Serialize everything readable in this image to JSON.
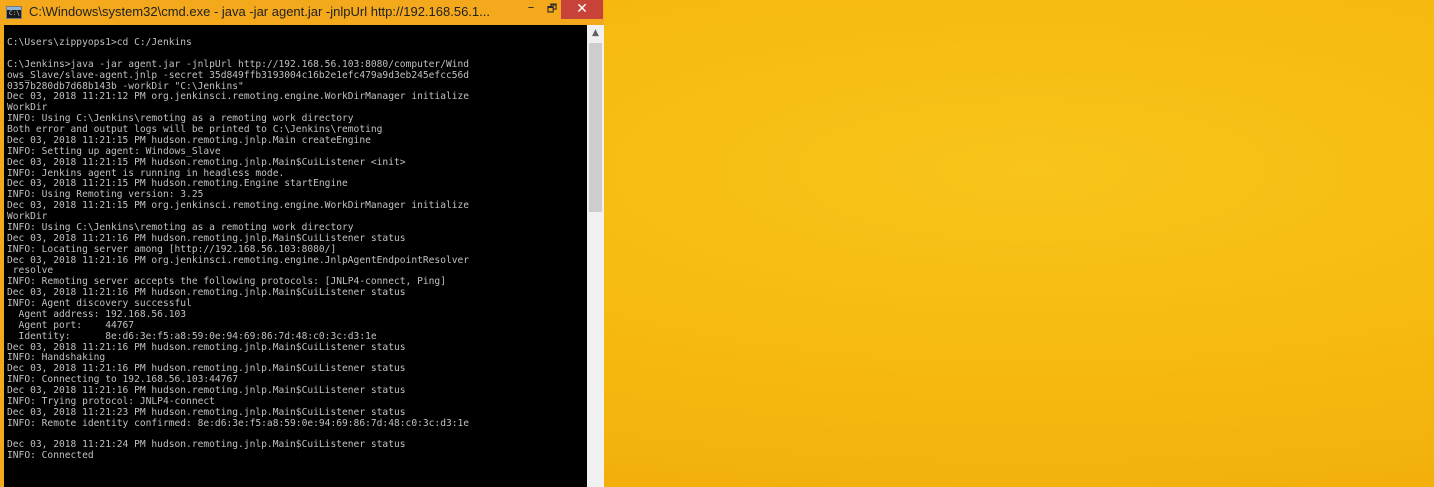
{
  "window": {
    "title": "C:\\Windows\\system32\\cmd.exe - java  -jar agent.jar -jnlpUrl http://192.168.56.1...",
    "icon": "cmd-icon",
    "icon_text": "C:\\",
    "minimize_label": "–",
    "maximize_label": "🗗",
    "close_label": "✕"
  },
  "scrollbar": {
    "up_arrow": "▲"
  },
  "console": {
    "lines": [
      "C:\\Users\\zippyops1>cd C:/Jenkins",
      "",
      "C:\\Jenkins>java -jar agent.jar -jnlpUrl http://192.168.56.103:8080/computer/Wind",
      "ows_Slave/slave-agent.jnlp -secret 35d849ffb3193004c16b2e1efc479a9d3eb245efcc56d",
      "0357b280db7d68b143b -workDir \"C:\\Jenkins\"",
      "Dec 03, 2018 11:21:12 PM org.jenkinsci.remoting.engine.WorkDirManager initialize",
      "WorkDir",
      "INFO: Using C:\\Jenkins\\remoting as a remoting work directory",
      "Both error and output logs will be printed to C:\\Jenkins\\remoting",
      "Dec 03, 2018 11:21:15 PM hudson.remoting.jnlp.Main createEngine",
      "INFO: Setting up agent: Windows_Slave",
      "Dec 03, 2018 11:21:15 PM hudson.remoting.jnlp.Main$CuiListener <init>",
      "INFO: Jenkins agent is running in headless mode.",
      "Dec 03, 2018 11:21:15 PM hudson.remoting.Engine startEngine",
      "INFO: Using Remoting version: 3.25",
      "Dec 03, 2018 11:21:15 PM org.jenkinsci.remoting.engine.WorkDirManager initialize",
      "WorkDir",
      "INFO: Using C:\\Jenkins\\remoting as a remoting work directory",
      "Dec 03, 2018 11:21:16 PM hudson.remoting.jnlp.Main$CuiListener status",
      "INFO: Locating server among [http://192.168.56.103:8080/]",
      "Dec 03, 2018 11:21:16 PM org.jenkinsci.remoting.engine.JnlpAgentEndpointResolver",
      " resolve",
      "INFO: Remoting server accepts the following protocols: [JNLP4-connect, Ping]",
      "Dec 03, 2018 11:21:16 PM hudson.remoting.jnlp.Main$CuiListener status",
      "INFO: Agent discovery successful",
      "  Agent address: 192.168.56.103",
      "  Agent port:    44767",
      "  Identity:      8e:d6:3e:f5:a8:59:0e:94:69:86:7d:48:c0:3c:d3:1e",
      "Dec 03, 2018 11:21:16 PM hudson.remoting.jnlp.Main$CuiListener status",
      "INFO: Handshaking",
      "Dec 03, 2018 11:21:16 PM hudson.remoting.jnlp.Main$CuiListener status",
      "INFO: Connecting to 192.168.56.103:44767",
      "Dec 03, 2018 11:21:16 PM hudson.remoting.jnlp.Main$CuiListener status",
      "INFO: Trying protocol: JNLP4-connect",
      "Dec 03, 2018 11:21:23 PM hudson.remoting.jnlp.Main$CuiListener status",
      "INFO: Remote identity confirmed: 8e:d6:3e:f5:a8:59:0e:94:69:86:7d:48:c0:3c:d3:1e",
      "",
      "Dec 03, 2018 11:21:24 PM hudson.remoting.jnlp.Main$CuiListener status",
      "INFO: Connected"
    ]
  },
  "colors": {
    "console_background": "#000000",
    "console_text": "#c0c0c0",
    "titlebar": "#f4a81c",
    "close_button": "#c7433a",
    "desktop": "#f6b90f"
  }
}
